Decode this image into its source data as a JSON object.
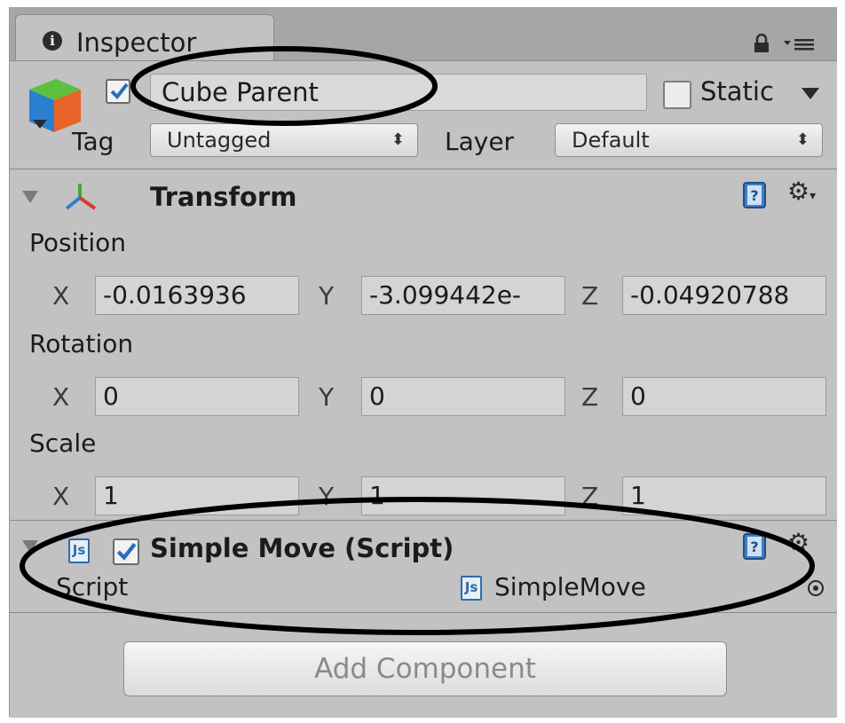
{
  "tab": {
    "title": "Inspector"
  },
  "header": {
    "object_name": "Cube Parent",
    "static_label": "Static",
    "tag_label": "Tag",
    "tag_value": "Untagged",
    "layer_label": "Layer",
    "layer_value": "Default"
  },
  "transform": {
    "title": "Transform",
    "rows": [
      {
        "label": "Position",
        "x": "-0.0163936",
        "y": "-3.099442e-",
        "z": "-0.04920788"
      },
      {
        "label": "Rotation",
        "x": "0",
        "y": "0",
        "z": "0"
      },
      {
        "label": "Scale",
        "x": "1",
        "y": "1",
        "z": "1"
      }
    ],
    "axis_x": "X",
    "axis_y": "Y",
    "axis_z": "Z"
  },
  "script_component": {
    "title": "Simple Move (Script)",
    "script_label": "Script",
    "script_value": "SimpleMove",
    "js_glyph": "Js"
  },
  "add_component_label": "Add Component",
  "icons": {
    "info": "info-icon",
    "lock": "lock-icon",
    "menu": "menu-icon",
    "cube": "cube-icon",
    "transform": "transform-axes-icon",
    "help": "help-book-icon",
    "gear": "gear-icon",
    "js": "js-script-icon",
    "target": "object-picker-icon"
  },
  "colors": {
    "panel_bg": "#c2c2c2",
    "tab_bar_bg": "#a6a6a6",
    "field_bg": "#d4d4d4",
    "check_blue": "#2a6ebf",
    "annotation_ellipse": "#000000"
  }
}
